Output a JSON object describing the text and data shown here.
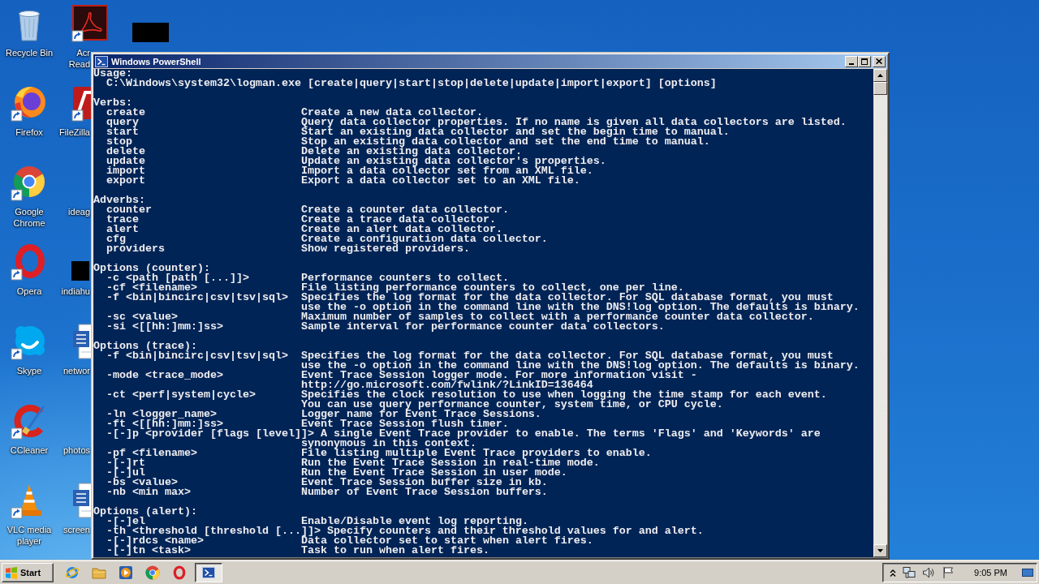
{
  "desktop": {
    "columns": [
      [
        {
          "kind": "recycle-bin",
          "label": "Recycle Bin"
        },
        {
          "kind": "firefox",
          "label": "Firefox"
        },
        {
          "kind": "chrome",
          "label": "Google Chrome"
        },
        {
          "kind": "opera",
          "label": "Opera"
        },
        {
          "kind": "skype",
          "label": "Skype"
        },
        {
          "kind": "ccleaner",
          "label": "CCleaner"
        },
        {
          "kind": "vlc",
          "label": "VLC media player"
        }
      ],
      [
        {
          "kind": "acrobat",
          "label": "Acr Read"
        },
        {
          "kind": "filezilla",
          "label": "FileZilla"
        },
        {
          "kind": "blank",
          "label": "ideag"
        },
        {
          "kind": "redacted",
          "label": "indiahu"
        },
        {
          "kind": "word",
          "label": "networ"
        },
        {
          "kind": "blank",
          "label": "photos"
        },
        {
          "kind": "word",
          "label": "screen"
        }
      ],
      [
        {
          "kind": "redacted"
        }
      ]
    ]
  },
  "window": {
    "title": "Windows PowerShell",
    "console": {
      "usage": {
        "heading": "Usage:",
        "command": "C:\\Windows\\system32\\logman.exe [create|query|start|stop|delete|update|import|export] [options]"
      },
      "sections": [
        {
          "heading": "Verbs:",
          "entries": [
            {
              "term": "create",
              "description": [
                "Create a new data collector."
              ]
            },
            {
              "term": "query",
              "description": [
                "Query data collector properties. If no name is given all data collectors are listed."
              ]
            },
            {
              "term": "start",
              "description": [
                "Start an existing data collector and set the begin time to manual."
              ]
            },
            {
              "term": "stop",
              "description": [
                "Stop an existing data collector and set the end time to manual."
              ]
            },
            {
              "term": "delete",
              "description": [
                "Delete an existing data collector."
              ]
            },
            {
              "term": "update",
              "description": [
                "Update an existing data collector's properties."
              ]
            },
            {
              "term": "import",
              "description": [
                "Import a data collector set from an XML file."
              ]
            },
            {
              "term": "export",
              "description": [
                "Export a data collector set to an XML file."
              ]
            }
          ]
        },
        {
          "heading": "Adverbs:",
          "entries": [
            {
              "term": "counter",
              "description": [
                "Create a counter data collector."
              ]
            },
            {
              "term": "trace",
              "description": [
                "Create a trace data collector."
              ]
            },
            {
              "term": "alert",
              "description": [
                "Create an alert data collector."
              ]
            },
            {
              "term": "cfg",
              "description": [
                "Create a configuration data collector."
              ]
            },
            {
              "term": "providers",
              "description": [
                "Show registered providers."
              ]
            }
          ]
        },
        {
          "heading": "Options (counter):",
          "entries": [
            {
              "term": "-c <path [path [...]]>",
              "description": [
                "Performance counters to collect."
              ]
            },
            {
              "term": "-cf <filename>",
              "description": [
                "File listing performance counters to collect, one per line."
              ]
            },
            {
              "term": "-f <bin|bincirc|csv|tsv|sql>",
              "description": [
                "Specifies the log format for the data collector. For SQL database format, you must",
                "use the -o option in the command line with the DNS!log option. The defaults is binary."
              ]
            },
            {
              "term": "-sc <value>",
              "description": [
                "Maximum number of samples to collect with a performance counter data collector."
              ]
            },
            {
              "term": "-si <[[hh:]mm:]ss>",
              "description": [
                "Sample interval for performance counter data collectors."
              ]
            }
          ]
        },
        {
          "heading": "Options (trace):",
          "entries": [
            {
              "term": "-f <bin|bincirc|csv|tsv|sql>",
              "description": [
                "Specifies the log format for the data collector. For SQL database format, you must",
                "use the -o option in the command line with the DNS!log option. The defaults is binary."
              ]
            },
            {
              "term": "-mode <trace_mode>",
              "description": [
                "Event Trace Session logger mode. For more information visit -",
                "http://go.microsoft.com/fwlink/?LinkID=136464"
              ]
            },
            {
              "term": "-ct <perf|system|cycle>",
              "description": [
                "Specifies the clock resolution to use when logging the time stamp for each event.",
                "You can use query performance counter, system time, or CPU cycle."
              ]
            },
            {
              "term": "-ln <logger_name>",
              "description": [
                "Logger name for Event Trace Sessions."
              ]
            },
            {
              "term": "-ft <[[hh:]mm:]ss>",
              "description": [
                "Event Trace Session flush timer."
              ]
            },
            {
              "term": "-[-]p <provider [flags [level]]>",
              "description": [
                "A single Event Trace provider to enable. The terms 'Flags' and 'Keywords' are",
                "synonymous in this context."
              ]
            },
            {
              "term": "-pf <filename>",
              "description": [
                "File listing multiple Event Trace providers to enable."
              ]
            },
            {
              "term": "-[-]rt",
              "description": [
                "Run the Event Trace Session in real-time mode."
              ]
            },
            {
              "term": "-[-]ul",
              "description": [
                "Run the Event Trace Session in user mode."
              ]
            },
            {
              "term": "-bs <value>",
              "description": [
                "Event Trace Session buffer size in kb."
              ]
            },
            {
              "term": "-nb <min max>",
              "description": [
                "Number of Event Trace Session buffers."
              ]
            }
          ]
        },
        {
          "heading": "Options (alert):",
          "entries": [
            {
              "term": "-[-]el",
              "description": [
                "Enable/Disable event log reporting."
              ]
            },
            {
              "term": "-th <threshold [threshold [...]]>",
              "description": [
                "Specify counters and their threshold values for and alert."
              ]
            },
            {
              "term": "-[-]rdcs <name>",
              "description": [
                "Data collector set to start when alert fires."
              ]
            },
            {
              "term": "-[-]tn <task>",
              "description": [
                "Task to run when alert fires."
              ]
            }
          ]
        }
      ]
    }
  },
  "taskbar": {
    "start": "Start",
    "quick_launch": [
      {
        "kind": "ie"
      },
      {
        "kind": "folder"
      },
      {
        "kind": "media-player"
      },
      {
        "kind": "chrome"
      },
      {
        "kind": "opera"
      }
    ],
    "tasks": [
      {
        "kind": "powershell",
        "selected": true
      }
    ],
    "tray": [
      {
        "kind": "chevron"
      },
      {
        "kind": "network"
      },
      {
        "kind": "volume"
      },
      {
        "kind": "flag"
      }
    ],
    "clock": "9:05 PM"
  }
}
